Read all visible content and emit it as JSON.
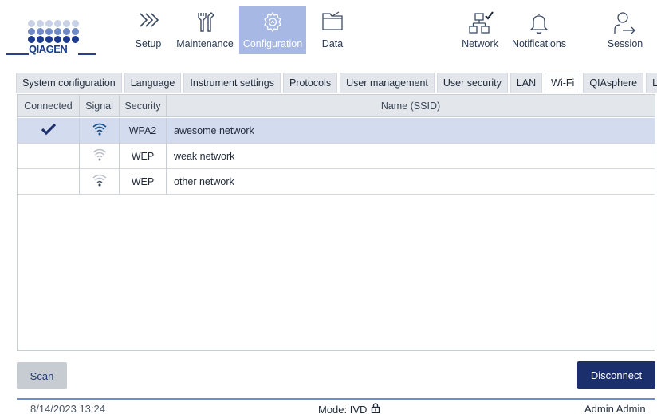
{
  "brand": {
    "name": "QIAGEN"
  },
  "nav": {
    "setup": "Setup",
    "maintenance": "Maintenance",
    "configuration": "Configuration",
    "data": "Data",
    "network": "Network",
    "notifications": "Notifications",
    "session": "Session"
  },
  "tabs": [
    {
      "label": "System configuration"
    },
    {
      "label": "Language"
    },
    {
      "label": "Instrument settings"
    },
    {
      "label": "Protocols"
    },
    {
      "label": "User management"
    },
    {
      "label": "User security"
    },
    {
      "label": "LAN"
    },
    {
      "label": "Wi-Fi"
    },
    {
      "label": "QIAsphere"
    },
    {
      "label": "LIMS"
    }
  ],
  "active_tab": "Wi-Fi",
  "table": {
    "headers": {
      "connected": "Connected",
      "signal": "Signal",
      "security": "Security",
      "name": "Name (SSID)"
    },
    "rows": [
      {
        "connected": true,
        "signal": "strong",
        "security": "WPA2",
        "name": "awesome network"
      },
      {
        "connected": false,
        "signal": "weak",
        "security": "WEP",
        "name": "weak network"
      },
      {
        "connected": false,
        "signal": "medium",
        "security": "WEP",
        "name": "other network"
      }
    ]
  },
  "buttons": {
    "scan": "Scan",
    "disconnect": "Disconnect"
  },
  "status": {
    "datetime": "8/14/2023 13:24",
    "mode": "Mode: IVD",
    "user": "Admin Admin"
  },
  "colors": {
    "accent": "#a6b8e3",
    "primary": "#1a2f6b",
    "selected_row": "#d3dcee"
  }
}
